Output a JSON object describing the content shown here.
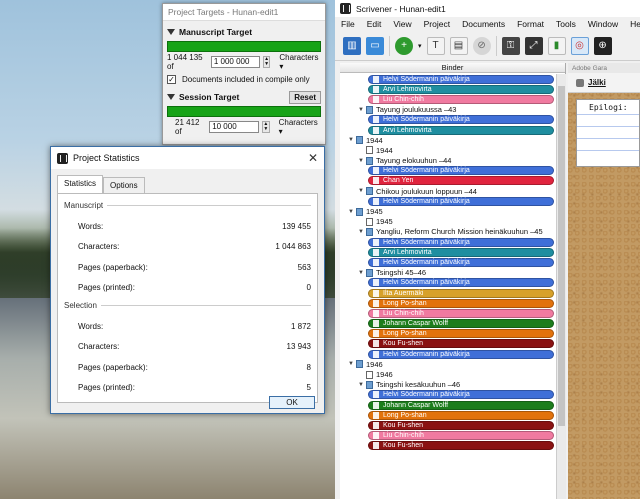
{
  "targets": {
    "window_title": "Project Targets - Hunan-edit1",
    "manuscript_label": "Manuscript Target",
    "manuscript_count": "1 044 135 of",
    "manuscript_value": "1 000 000",
    "manuscript_unit": "Characters",
    "compile_only_label": "Documents included in compile only",
    "session_label": "Session Target",
    "reset_label": "Reset",
    "session_count": "21 412 of",
    "session_value": "10 000",
    "session_unit": "Characters"
  },
  "stats": {
    "window_title": "Project Statistics",
    "tabs": [
      "Statistics",
      "Options"
    ],
    "manuscript_section": "Manuscript",
    "manuscript_rows": [
      {
        "label": "Words:",
        "value": "139 455"
      },
      {
        "label": "Characters:",
        "value": "1 044 863"
      },
      {
        "label": "Pages (paperback):",
        "value": "563"
      },
      {
        "label": "Pages (printed):",
        "value": "0"
      }
    ],
    "selection_section": "Selection",
    "selection_rows": [
      {
        "label": "Words:",
        "value": "1 872"
      },
      {
        "label": "Characters:",
        "value": "13 943"
      },
      {
        "label": "Pages (paperback):",
        "value": "8"
      },
      {
        "label": "Pages (printed):",
        "value": "5"
      }
    ],
    "ok_label": "OK"
  },
  "scrivener": {
    "window_title": "Scrivener - Hunan-edit1",
    "menu": [
      "File",
      "Edit",
      "View",
      "Project",
      "Documents",
      "Format",
      "Tools",
      "Window",
      "Help"
    ],
    "binder_header": "Binder",
    "editor_tabs": [
      "Adobe Gara"
    ],
    "editor_title": "Jälki",
    "card_title": "Epilogi:",
    "binder_items": [
      {
        "type": "pill",
        "text": "Helvi Södermanin päiväkirja",
        "color": "#3f6fd8",
        "indent": 2
      },
      {
        "type": "pill",
        "text": "Arvi Lehmovirta",
        "color": "#1f8ea0",
        "indent": 2
      },
      {
        "type": "pill",
        "text": "Liu Chin-chih",
        "color": "#f07aa0",
        "indent": 2
      },
      {
        "type": "folder",
        "text": "Tayung joulukuussa –43",
        "indent": 1
      },
      {
        "type": "pill",
        "text": "Helvi Södermanin päiväkirja",
        "color": "#3f6fd8",
        "indent": 2
      },
      {
        "type": "pill",
        "text": "Arvi Lehmovirta",
        "color": "#1f8ea0",
        "indent": 2
      },
      {
        "type": "folder",
        "text": "1944",
        "indent": 0
      },
      {
        "type": "doc",
        "text": "1944",
        "indent": 1
      },
      {
        "type": "folder",
        "text": "Tayung elokuuhun –44",
        "indent": 1
      },
      {
        "type": "pill",
        "text": "Helvi Södermanin päiväkirja",
        "color": "#3f6fd8",
        "indent": 2
      },
      {
        "type": "pill",
        "text": "Chan Yen",
        "color": "#e0243e",
        "indent": 2
      },
      {
        "type": "folder",
        "text": "Chikou joulukuun loppuun –44",
        "indent": 1
      },
      {
        "type": "pill",
        "text": "Helvi Södermanin päiväkirja",
        "color": "#3f6fd8",
        "indent": 2
      },
      {
        "type": "folder",
        "text": "1945",
        "indent": 0
      },
      {
        "type": "doc",
        "text": "1945",
        "indent": 1
      },
      {
        "type": "folder",
        "text": "Yangliu, Reform Church Mission heinäkuuhun –45",
        "indent": 1
      },
      {
        "type": "pill",
        "text": "Helvi Södermanin päiväkirja",
        "color": "#3f6fd8",
        "indent": 2
      },
      {
        "type": "pill",
        "text": "Arvi Lehmovirta",
        "color": "#1f8ea0",
        "indent": 2
      },
      {
        "type": "pill",
        "text": "Helvi Södermanin päiväkirja",
        "color": "#3f6fd8",
        "indent": 2
      },
      {
        "type": "folder",
        "text": "Tsingshi 45–46",
        "indent": 1
      },
      {
        "type": "pill",
        "text": "Helvi Södermanin päiväkirja",
        "color": "#3f6fd8",
        "indent": 2
      },
      {
        "type": "pill",
        "text": "Ilta Auermäki",
        "color": "#d7a12a",
        "indent": 2
      },
      {
        "type": "pill",
        "text": "Long Po-shan",
        "color": "#e2720c",
        "indent": 2
      },
      {
        "type": "pill",
        "text": "Liu Chin-chih",
        "color": "#f07aa0",
        "indent": 2
      },
      {
        "type": "pill",
        "text": "Johann Caspar Wolff",
        "color": "#1c7d1c",
        "indent": 2
      },
      {
        "type": "pill",
        "text": "Long Po-shan",
        "color": "#e2720c",
        "indent": 2
      },
      {
        "type": "pill",
        "text": "Kou Fu-shen",
        "color": "#8a1212",
        "indent": 2
      },
      {
        "type": "pill",
        "text": "Helvi Södermanin päiväkirja",
        "color": "#3f6fd8",
        "indent": 2
      },
      {
        "type": "folder",
        "text": "1946",
        "indent": 0
      },
      {
        "type": "doc",
        "text": "1946",
        "indent": 1
      },
      {
        "type": "folder",
        "text": "Tsingshi kesäkuuhun –46",
        "indent": 1
      },
      {
        "type": "pill",
        "text": "Helvi Södermanin päiväkirja",
        "color": "#3f6fd8",
        "indent": 2
      },
      {
        "type": "pill",
        "text": "Johann Caspar Wolff",
        "color": "#1c7d1c",
        "indent": 2
      },
      {
        "type": "pill",
        "text": "Long Po-shan",
        "color": "#e2720c",
        "indent": 2
      },
      {
        "type": "pill",
        "text": "Kou Fu-shen",
        "color": "#8a1212",
        "indent": 2
      },
      {
        "type": "pill",
        "text": "Liu Chin-chih",
        "color": "#f07aa0",
        "indent": 2
      },
      {
        "type": "pill",
        "text": "Kou Fu-shen",
        "color": "#8a1212",
        "indent": 2
      }
    ]
  }
}
